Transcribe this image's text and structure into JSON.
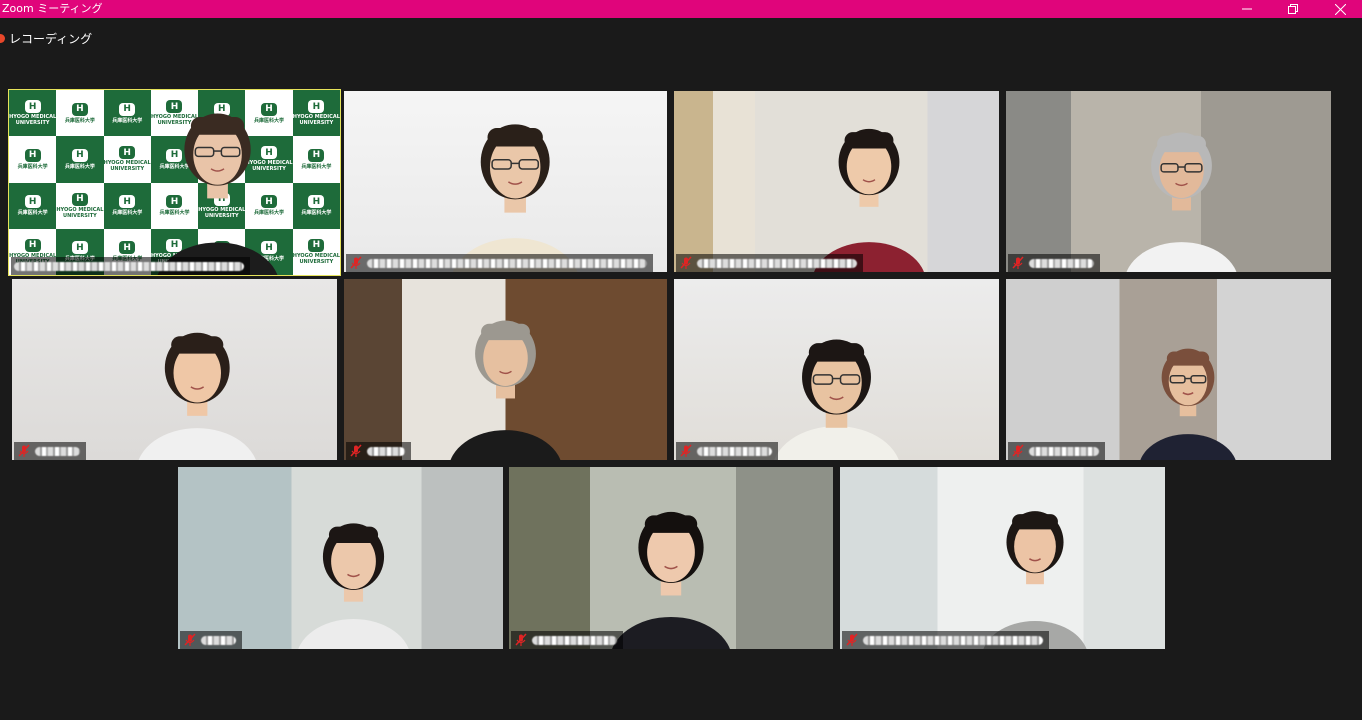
{
  "window": {
    "title": "Zoom ミーティング",
    "controls": {
      "minimize_icon": "minimize-icon",
      "restore_icon": "restore-icon",
      "close_icon": "close-icon"
    }
  },
  "recording": {
    "label": "レコーディング",
    "icon": "record-dot-icon"
  },
  "colors": {
    "titlebar": "#e0057b",
    "background": "#1a1a1a",
    "active_speaker": "#e6e35a",
    "mic_muted": "#e02424"
  },
  "brand_backdrop": {
    "logo_glyph": "H",
    "text_en_line1": "HYOGO MEDICAL",
    "text_en_line2": "UNIVERSITY",
    "text_ja": "兵庫医科大学"
  },
  "participants": [
    {
      "id": "p1",
      "name_hidden": true,
      "muted": false,
      "active_speaker": true
    },
    {
      "id": "p2",
      "name_hidden": true,
      "muted": true,
      "active_speaker": false
    },
    {
      "id": "p3",
      "name_hidden": true,
      "muted": true,
      "active_speaker": false
    },
    {
      "id": "p4",
      "name_hidden": true,
      "muted": true,
      "active_speaker": false
    },
    {
      "id": "p5",
      "name_hidden": true,
      "muted": true,
      "active_speaker": false
    },
    {
      "id": "p6",
      "name_hidden": true,
      "muted": true,
      "active_speaker": false
    },
    {
      "id": "p7",
      "name_hidden": true,
      "muted": true,
      "active_speaker": false
    },
    {
      "id": "p8",
      "name_hidden": true,
      "muted": true,
      "active_speaker": false
    },
    {
      "id": "p9",
      "name_hidden": true,
      "muted": true,
      "active_speaker": false
    },
    {
      "id": "p10",
      "name_hidden": true,
      "muted": true,
      "active_speaker": false
    },
    {
      "id": "p11",
      "name_hidden": true,
      "muted": true,
      "active_speaker": false
    }
  ]
}
